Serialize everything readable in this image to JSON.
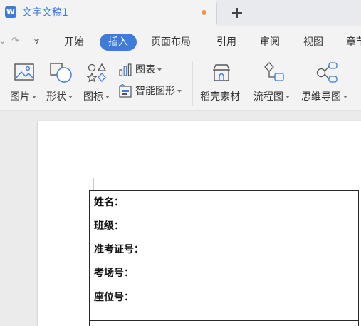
{
  "window": {
    "doc_title": "文字文稿1",
    "app_logo_letter": "W"
  },
  "menu": {
    "quick_undo_glyph": "⌄",
    "quick_redo_glyph": "↷",
    "quick_more_glyph": "⩔",
    "tabs": [
      {
        "label": "开始"
      },
      {
        "label": "插入",
        "active": true
      },
      {
        "label": "页面布局"
      },
      {
        "label": "引用"
      },
      {
        "label": "审阅"
      },
      {
        "label": "视图"
      },
      {
        "label": "章节"
      }
    ],
    "active_color": "#3f7bd9"
  },
  "ribbon": {
    "picture": "图片",
    "shape": "形状",
    "icon": "图标",
    "chart": "图表",
    "smart_graphic": "智能图形",
    "daoke_material": "稻壳素材",
    "flowchart": "流程图",
    "mindmap": "思维导图"
  },
  "document": {
    "fields": [
      {
        "label": "姓名："
      },
      {
        "label": "班级："
      },
      {
        "label": "准考证号："
      },
      {
        "label": "考场号："
      },
      {
        "label": "座位号："
      }
    ]
  },
  "colors": {
    "brand_blue": "#3f7bd9",
    "unsaved_dot": "#ea9a4e"
  }
}
